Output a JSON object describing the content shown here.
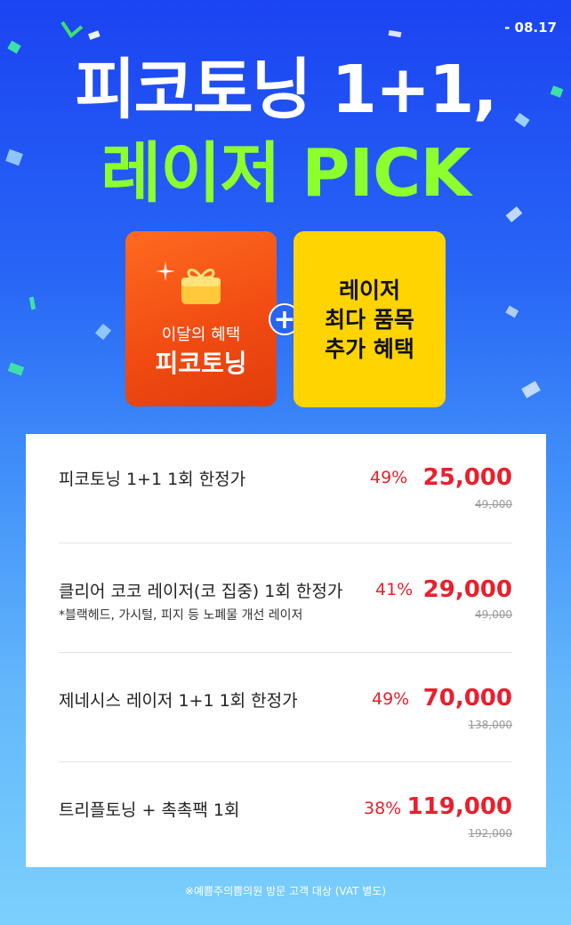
{
  "date": "- 08.17",
  "title_line1": "피코토닝 1+1,",
  "title_line2": "레이저 PICK",
  "promo_left": {
    "sub": "이달의 혜택",
    "main": "피코토닝",
    "icon": "gift-icon"
  },
  "plus_symbol": "+",
  "promo_right": {
    "line1": "레이저",
    "line2": "최다 품목",
    "line3": "추가 혜택"
  },
  "items": [
    {
      "name": "피코토닝 1+1 1회 한정가",
      "note": "",
      "discount": "49%",
      "price": "25,000",
      "original": "49,000"
    },
    {
      "name": "클리어 코코 레이저(코 집중) 1회 한정가",
      "note": "*블랙헤드, 가시털, 피지 등 노폐물 개선 레이저",
      "discount": "41%",
      "price": "29,000",
      "original": "49,000"
    },
    {
      "name": "제네시스 레이저 1+1 1회 한정가",
      "note": "",
      "discount": "49%",
      "price": "70,000",
      "original": "138,000"
    },
    {
      "name": "트리플토닝 + 촉촉팩 1회",
      "note": "",
      "discount": "38%",
      "price": "119,000",
      "original": "192,000"
    }
  ],
  "footnote": "※예쁨주의쁨의원 방문 고객 대상 (VAT 별도)",
  "colors": {
    "accent_green": "#8dff2d",
    "price_red": "#e8202e",
    "card_orange": "#f04a12",
    "card_yellow": "#ffd400"
  }
}
